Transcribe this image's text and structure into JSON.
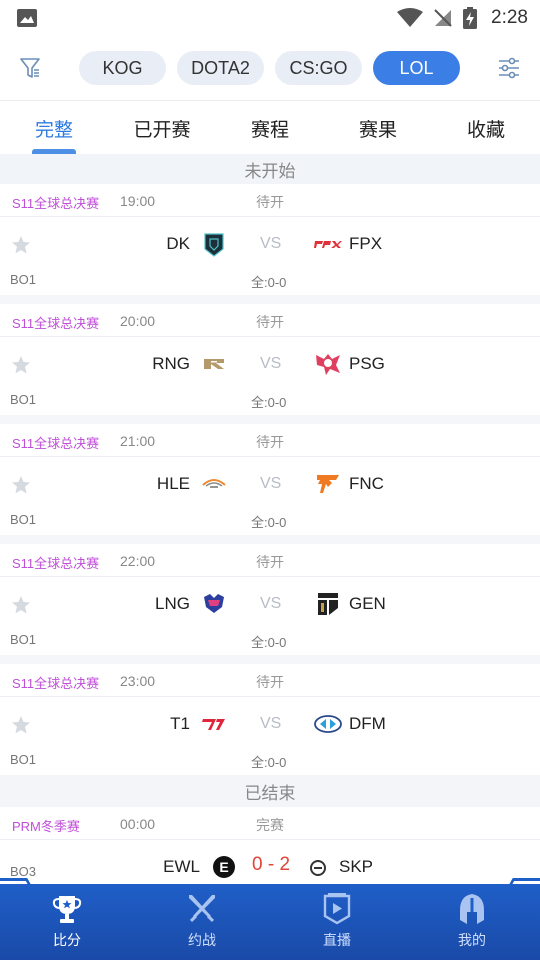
{
  "status_bar": {
    "time": "2:28"
  },
  "game_filters": [
    {
      "label": "KOG",
      "active": false
    },
    {
      "label": "DOTA2",
      "active": false
    },
    {
      "label": "CS:GO",
      "active": false
    },
    {
      "label": "LOL",
      "active": true
    }
  ],
  "tabs": [
    {
      "label": "完整",
      "active": true
    },
    {
      "label": "已开赛",
      "active": false
    },
    {
      "label": "赛程",
      "active": false
    },
    {
      "label": "赛果",
      "active": false
    },
    {
      "label": "收藏",
      "active": false
    }
  ],
  "sections": {
    "upcoming": "未开始",
    "finished": "已结束"
  },
  "matches": [
    {
      "event": "S11全球总决赛",
      "time": "19:00",
      "status": "待开",
      "home": "DK",
      "vs": "VS",
      "away": "FPX",
      "format": "BO1",
      "score": "全:0-0"
    },
    {
      "event": "S11全球总决赛",
      "time": "20:00",
      "status": "待开",
      "home": "RNG",
      "vs": "VS",
      "away": "PSG",
      "format": "BO1",
      "score": "全:0-0"
    },
    {
      "event": "S11全球总决赛",
      "time": "21:00",
      "status": "待开",
      "home": "HLE",
      "vs": "VS",
      "away": "FNC",
      "format": "BO1",
      "score": "全:0-0"
    },
    {
      "event": "S11全球总决赛",
      "time": "22:00",
      "status": "待开",
      "home": "LNG",
      "vs": "VS",
      "away": "GEN",
      "format": "BO1",
      "score": "全:0-0"
    },
    {
      "event": "S11全球总决赛",
      "time": "23:00",
      "status": "待开",
      "home": "T1",
      "vs": "VS",
      "away": "DFM",
      "format": "BO1",
      "score": "全:0-0"
    }
  ],
  "finished_match": {
    "event": "PRM冬季赛",
    "time": "00:00",
    "status": "完赛",
    "home": "EWL",
    "result": "0 - 2",
    "away": "SKP",
    "format": "BO3"
  },
  "bottom_nav": [
    {
      "label": "比分",
      "icon": "trophy-icon",
      "active": true
    },
    {
      "label": "约战",
      "icon": "crossed-swords-icon",
      "active": false
    },
    {
      "label": "直播",
      "icon": "live-play-icon",
      "active": false
    },
    {
      "label": "我的",
      "icon": "helmet-icon",
      "active": false
    }
  ],
  "colors": {
    "accent": "#2e7be0",
    "event": "#c04fd8",
    "nav_bg": "#1f5fc8",
    "loss": "#e0443a"
  }
}
